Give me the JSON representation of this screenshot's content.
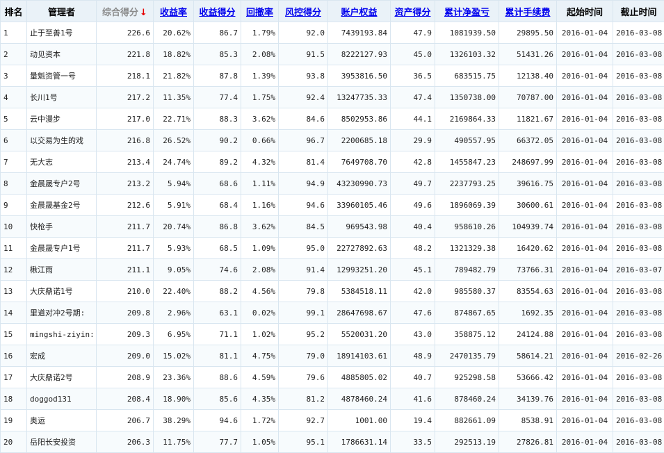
{
  "table": {
    "headers": {
      "rank": "排名",
      "manager": "管理者",
      "composite": "综合得分",
      "return_rate": "收益率",
      "return_score": "收益得分",
      "drawdown": "回撤率",
      "risk_score": "风控得分",
      "equity": "账户权益",
      "asset_score": "资产得分",
      "net_pnl": "累计净盈亏",
      "fees": "累计手续费",
      "start": "起始时间",
      "end": "截止时间"
    },
    "sort_indicator": "↓",
    "rows": [
      {
        "rank": "1",
        "manager": "止于至善1号",
        "composite": "226.6",
        "return_rate": "20.62%",
        "return_score": "86.7",
        "drawdown": "1.79%",
        "risk_score": "92.0",
        "equity": "7439193.84",
        "asset_score": "47.9",
        "net_pnl": "1081939.50",
        "fees": "29895.50",
        "start": "2016-01-04",
        "end": "2016-03-08"
      },
      {
        "rank": "2",
        "manager": "动见资本",
        "composite": "221.8",
        "return_rate": "18.82%",
        "return_score": "85.3",
        "drawdown": "2.08%",
        "risk_score": "91.5",
        "equity": "8222127.93",
        "asset_score": "45.0",
        "net_pnl": "1326103.32",
        "fees": "51431.26",
        "start": "2016-01-04",
        "end": "2016-03-08"
      },
      {
        "rank": "3",
        "manager": "量魁资管一号",
        "composite": "218.1",
        "return_rate": "21.82%",
        "return_score": "87.8",
        "drawdown": "1.39%",
        "risk_score": "93.8",
        "equity": "3953816.50",
        "asset_score": "36.5",
        "net_pnl": "683515.75",
        "fees": "12138.40",
        "start": "2016-01-04",
        "end": "2016-03-08"
      },
      {
        "rank": "4",
        "manager": "长川1号",
        "composite": "217.2",
        "return_rate": "11.35%",
        "return_score": "77.4",
        "drawdown": "1.75%",
        "risk_score": "92.4",
        "equity": "13247735.33",
        "asset_score": "47.4",
        "net_pnl": "1350738.00",
        "fees": "70787.00",
        "start": "2016-01-04",
        "end": "2016-03-08"
      },
      {
        "rank": "5",
        "manager": "云中漫步",
        "composite": "217.0",
        "return_rate": "22.71%",
        "return_score": "88.3",
        "drawdown": "3.62%",
        "risk_score": "84.6",
        "equity": "8502953.86",
        "asset_score": "44.1",
        "net_pnl": "2169864.33",
        "fees": "11821.67",
        "start": "2016-01-04",
        "end": "2016-03-08"
      },
      {
        "rank": "6",
        "manager": "以交易为生的戏",
        "composite": "216.8",
        "return_rate": "26.52%",
        "return_score": "90.2",
        "drawdown": "0.66%",
        "risk_score": "96.7",
        "equity": "2200685.18",
        "asset_score": "29.9",
        "net_pnl": "490557.95",
        "fees": "66372.05",
        "start": "2016-01-04",
        "end": "2016-03-08"
      },
      {
        "rank": "7",
        "manager": "无大志",
        "composite": "213.4",
        "return_rate": "24.74%",
        "return_score": "89.2",
        "drawdown": "4.32%",
        "risk_score": "81.4",
        "equity": "7649708.70",
        "asset_score": "42.8",
        "net_pnl": "1455847.23",
        "fees": "248697.99",
        "start": "2016-01-04",
        "end": "2016-03-08"
      },
      {
        "rank": "8",
        "manager": "金晨晟专户2号",
        "composite": "213.2",
        "return_rate": "5.94%",
        "return_score": "68.6",
        "drawdown": "1.11%",
        "risk_score": "94.9",
        "equity": "43230990.73",
        "asset_score": "49.7",
        "net_pnl": "2237793.25",
        "fees": "39616.75",
        "start": "2016-01-04",
        "end": "2016-03-08"
      },
      {
        "rank": "9",
        "manager": "金晨晟基金2号",
        "composite": "212.6",
        "return_rate": "5.91%",
        "return_score": "68.4",
        "drawdown": "1.16%",
        "risk_score": "94.6",
        "equity": "33960105.46",
        "asset_score": "49.6",
        "net_pnl": "1896069.39",
        "fees": "30600.61",
        "start": "2016-01-04",
        "end": "2016-03-08"
      },
      {
        "rank": "10",
        "manager": "快枪手",
        "composite": "211.7",
        "return_rate": "20.74%",
        "return_score": "86.8",
        "drawdown": "3.62%",
        "risk_score": "84.5",
        "equity": "969543.98",
        "asset_score": "40.4",
        "net_pnl": "958610.26",
        "fees": "104939.74",
        "start": "2016-01-04",
        "end": "2016-03-08"
      },
      {
        "rank": "11",
        "manager": "金晨晟专户1号",
        "composite": "211.7",
        "return_rate": "5.93%",
        "return_score": "68.5",
        "drawdown": "1.09%",
        "risk_score": "95.0",
        "equity": "22727892.63",
        "asset_score": "48.2",
        "net_pnl": "1321329.38",
        "fees": "16420.62",
        "start": "2016-01-04",
        "end": "2016-03-08"
      },
      {
        "rank": "12",
        "manager": "楸江雨",
        "composite": "211.1",
        "return_rate": "9.05%",
        "return_score": "74.6",
        "drawdown": "2.08%",
        "risk_score": "91.4",
        "equity": "12993251.20",
        "asset_score": "45.1",
        "net_pnl": "789482.79",
        "fees": "73766.31",
        "start": "2016-01-04",
        "end": "2016-03-07"
      },
      {
        "rank": "13",
        "manager": "大庆鼎诺1号",
        "composite": "210.0",
        "return_rate": "22.40%",
        "return_score": "88.2",
        "drawdown": "4.56%",
        "risk_score": "79.8",
        "equity": "5384518.11",
        "asset_score": "42.0",
        "net_pnl": "985580.37",
        "fees": "83554.63",
        "start": "2016-01-04",
        "end": "2016-03-08"
      },
      {
        "rank": "14",
        "manager": "里道对冲2号期:",
        "composite": "209.8",
        "return_rate": "2.96%",
        "return_score": "63.1",
        "drawdown": "0.02%",
        "risk_score": "99.1",
        "equity": "28647698.67",
        "asset_score": "47.6",
        "net_pnl": "874867.65",
        "fees": "1692.35",
        "start": "2016-01-04",
        "end": "2016-03-08"
      },
      {
        "rank": "15",
        "manager": "mingshi-ziyin:",
        "composite": "209.3",
        "return_rate": "6.95%",
        "return_score": "71.1",
        "drawdown": "1.02%",
        "risk_score": "95.2",
        "equity": "5520031.20",
        "asset_score": "43.0",
        "net_pnl": "358875.12",
        "fees": "24124.88",
        "start": "2016-01-04",
        "end": "2016-03-08"
      },
      {
        "rank": "16",
        "manager": "宏成",
        "composite": "209.0",
        "return_rate": "15.02%",
        "return_score": "81.1",
        "drawdown": "4.75%",
        "risk_score": "79.0",
        "equity": "18914103.61",
        "asset_score": "48.9",
        "net_pnl": "2470135.79",
        "fees": "58614.21",
        "start": "2016-01-04",
        "end": "2016-02-26"
      },
      {
        "rank": "17",
        "manager": "大庆鼎诺2号",
        "composite": "208.9",
        "return_rate": "23.36%",
        "return_score": "88.6",
        "drawdown": "4.59%",
        "risk_score": "79.6",
        "equity": "4885805.02",
        "asset_score": "40.7",
        "net_pnl": "925298.58",
        "fees": "53666.42",
        "start": "2016-01-04",
        "end": "2016-03-08"
      },
      {
        "rank": "18",
        "manager": "doggod131",
        "composite": "208.4",
        "return_rate": "18.90%",
        "return_score": "85.6",
        "drawdown": "4.35%",
        "risk_score": "81.2",
        "equity": "4878460.24",
        "asset_score": "41.6",
        "net_pnl": "878460.24",
        "fees": "34139.76",
        "start": "2016-01-04",
        "end": "2016-03-08"
      },
      {
        "rank": "19",
        "manager": "奥运",
        "composite": "206.7",
        "return_rate": "38.29%",
        "return_score": "94.6",
        "drawdown": "1.72%",
        "risk_score": "92.7",
        "equity": "1001.00",
        "asset_score": "19.4",
        "net_pnl": "882661.09",
        "fees": "8538.91",
        "start": "2016-01-04",
        "end": "2016-03-08"
      },
      {
        "rank": "20",
        "manager": "岳阳长安投资",
        "composite": "206.3",
        "return_rate": "11.75%",
        "return_score": "77.7",
        "drawdown": "1.05%",
        "risk_score": "95.1",
        "equity": "1786631.14",
        "asset_score": "33.5",
        "net_pnl": "292513.19",
        "fees": "27826.81",
        "start": "2016-01-04",
        "end": "2016-03-08"
      }
    ]
  }
}
